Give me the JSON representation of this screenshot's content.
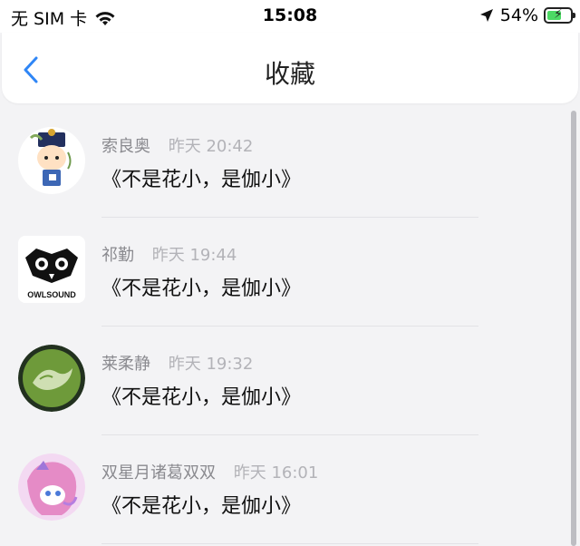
{
  "status": {
    "carrier": "无 SIM 卡",
    "time": "15:08",
    "battery": "54%",
    "battery_level": 0.54
  },
  "nav": {
    "title": "收藏"
  },
  "items": [
    {
      "name": "索良奥",
      "time": "昨天 20:42",
      "content": "《不是花小，是伽小》"
    },
    {
      "name": "祁勤",
      "time": "昨天 19:44",
      "content": "《不是花小，是伽小》",
      "logo_text": "OWLSOUND"
    },
    {
      "name": "莱柔静",
      "time": "昨天 19:32",
      "content": "《不是花小，是伽小》"
    },
    {
      "name": "双星月诸葛双双",
      "time": "昨天 16:01",
      "content": "《不是花小，是伽小》"
    }
  ]
}
